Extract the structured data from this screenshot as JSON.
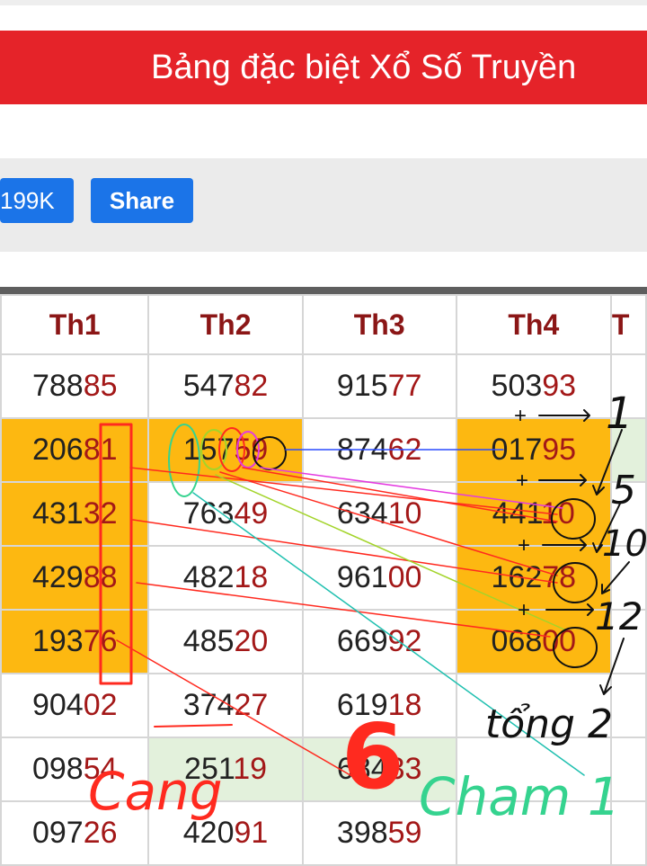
{
  "banner": {
    "title": "Bảng đặc biệt Xổ Số Truyền"
  },
  "share_bar": {
    "count_label": "199K",
    "share_label": "Share"
  },
  "table": {
    "headers": [
      "Th1",
      "Th2",
      "Th3",
      "Th4",
      "T"
    ],
    "rows": [
      {
        "cells": [
          {
            "pre": "788",
            "post": "85",
            "bg": "white"
          },
          {
            "pre": "547",
            "post": "82",
            "bg": "white"
          },
          {
            "pre": "915",
            "post": "77",
            "bg": "white"
          },
          {
            "pre": "503",
            "post": "93",
            "bg": "white"
          },
          {
            "pre": "",
            "post": "",
            "bg": "white"
          }
        ]
      },
      {
        "cells": [
          {
            "pre": "206",
            "post": "81",
            "bg": "orange"
          },
          {
            "pre": "157",
            "post": "59",
            "bg": "orange"
          },
          {
            "pre": "874",
            "post": "62",
            "bg": "white"
          },
          {
            "pre": "017",
            "post": "95",
            "bg": "orange"
          },
          {
            "pre": "",
            "post": "",
            "bg": "green"
          }
        ]
      },
      {
        "cells": [
          {
            "pre": "431",
            "post": "32",
            "bg": "orange"
          },
          {
            "pre": "763",
            "post": "49",
            "bg": "white"
          },
          {
            "pre": "634",
            "post": "10",
            "bg": "white"
          },
          {
            "pre": "441",
            "post": "10",
            "bg": "orange"
          },
          {
            "pre": "",
            "post": "",
            "bg": "white"
          }
        ]
      },
      {
        "cells": [
          {
            "pre": "429",
            "post": "88",
            "bg": "orange"
          },
          {
            "pre": "482",
            "post": "18",
            "bg": "white"
          },
          {
            "pre": "961",
            "post": "00",
            "bg": "white"
          },
          {
            "pre": "162",
            "post": "78",
            "bg": "orange"
          },
          {
            "pre": "",
            "post": "",
            "bg": "white"
          }
        ]
      },
      {
        "cells": [
          {
            "pre": "193",
            "post": "76",
            "bg": "orange"
          },
          {
            "pre": "485",
            "post": "20",
            "bg": "white"
          },
          {
            "pre": "669",
            "post": "92",
            "bg": "white"
          },
          {
            "pre": "068",
            "post": "00",
            "bg": "orange"
          },
          {
            "pre": "",
            "post": "",
            "bg": "white"
          }
        ]
      },
      {
        "cells": [
          {
            "pre": "904",
            "post": "02",
            "bg": "white"
          },
          {
            "pre": "374",
            "post": "27",
            "bg": "white"
          },
          {
            "pre": "619",
            "post": "18",
            "bg": "white"
          },
          {
            "pre": "",
            "post": "",
            "bg": "white"
          },
          {
            "pre": "",
            "post": "",
            "bg": "white"
          }
        ]
      },
      {
        "cells": [
          {
            "pre": "098",
            "post": "54",
            "bg": "white"
          },
          {
            "pre": "251",
            "post": "19",
            "bg": "green"
          },
          {
            "pre": "684",
            "post": "33",
            "bg": "green"
          },
          {
            "pre": "",
            "post": "",
            "bg": "white"
          },
          {
            "pre": "",
            "post": "",
            "bg": "white"
          }
        ]
      },
      {
        "cells": [
          {
            "pre": "097",
            "post": "26",
            "bg": "white"
          },
          {
            "pre": "420",
            "post": "91",
            "bg": "white"
          },
          {
            "pre": "398",
            "post": "59",
            "bg": "white"
          },
          {
            "pre": "",
            "post": "",
            "bg": "white"
          },
          {
            "pre": "",
            "post": "",
            "bg": "white"
          }
        ]
      }
    ]
  },
  "annotations": {
    "labels": [
      "1",
      "5",
      "10",
      "12",
      "tổng 2",
      "6",
      "Cang",
      "Cham 1",
      "+",
      "+",
      "+",
      "+"
    ],
    "colors": {
      "red": "#ff2a1f",
      "black": "#111111",
      "green": "#35d38f",
      "blue": "#2a4bff",
      "magenta": "#e43ae0",
      "yellowgreen": "#a3d42a",
      "teal": "#20c0b0"
    }
  },
  "colors": {
    "banner": "#e52329",
    "button": "#1b74e8",
    "header_text": "#8b1616",
    "digit_highlight": "#a31818",
    "orange": "#fdb811",
    "green": "#e3f1dc"
  }
}
